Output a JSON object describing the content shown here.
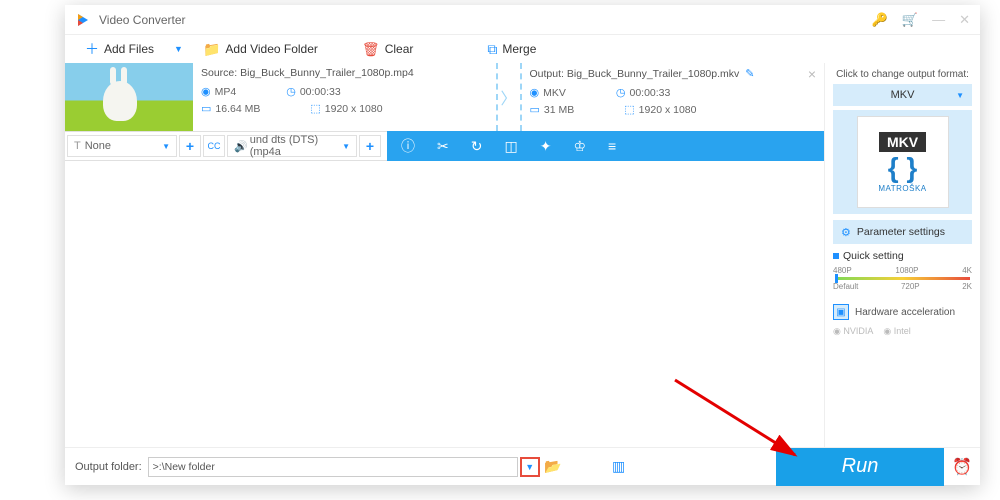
{
  "app": {
    "title": "Video Converter"
  },
  "toolbar": {
    "add_files": "Add Files",
    "add_folder": "Add Video Folder",
    "clear": "Clear",
    "merge": "Merge"
  },
  "file": {
    "source_label": "Source:",
    "source_name": "Big_Buck_Bunny_Trailer_1080p.mp4",
    "output_label": "Output:",
    "output_name": "Big_Buck_Bunny_Trailer_1080p.mkv",
    "src": {
      "format": "MP4",
      "duration": "00:00:33",
      "size": "16.64 MB",
      "resolution": "1920 x 1080"
    },
    "out": {
      "format": "MKV",
      "duration": "00:00:33",
      "size": "31 MB",
      "resolution": "1920 x 1080"
    }
  },
  "editbar": {
    "subtitle": "None",
    "audio": "und dts (DTS) (mp4a"
  },
  "side": {
    "hint": "Click to change output format:",
    "format": "MKV",
    "logo_text": "MKV",
    "logo_sub": "MATROŠKA",
    "param_btn": "Parameter settings",
    "quick_label": "Quick setting",
    "ticks_top": [
      "480P",
      "1080P",
      "4K"
    ],
    "ticks_bot": [
      "Default",
      "720P",
      "2K"
    ],
    "hw_label": "Hardware acceleration",
    "gpu1": "NVIDIA",
    "gpu2": "Intel"
  },
  "footer": {
    "label": "Output folder:",
    "path": ">:\\New folder",
    "run": "Run"
  }
}
